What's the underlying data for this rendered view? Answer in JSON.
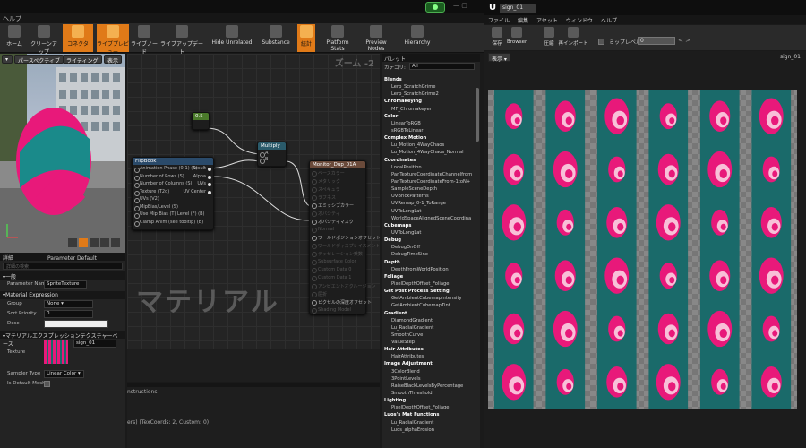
{
  "window": {
    "menu_label": "ヘルプ"
  },
  "toolbar": {
    "buttons": [
      {
        "label": "ホーム",
        "icon": "home-icon",
        "active": false
      },
      {
        "label": "クリーンアップ",
        "icon": "cleanup-icon",
        "active": false
      },
      {
        "label": "コネクタ",
        "icon": "connector-icon",
        "active": true
      },
      {
        "label": "ライブプレビュー",
        "icon": "live-preview-icon",
        "active": true
      },
      {
        "label": "ライブノード",
        "icon": "live-nodes-icon",
        "active": false
      },
      {
        "label": "ライブアップデート",
        "icon": "live-update-icon",
        "active": false
      },
      {
        "label": "Hide Unrelated",
        "icon": "hide-unrelated-icon",
        "active": false
      },
      {
        "label": "Substance",
        "icon": "substance-icon",
        "active": false
      },
      {
        "label": "統計",
        "icon": "stats-icon",
        "active": true
      },
      {
        "label": "Platform Stats",
        "icon": "platform-stats-icon",
        "active": false
      },
      {
        "label": "Preview Nodes",
        "icon": "preview-nodes-icon",
        "active": false
      },
      {
        "label": "Hierarchy",
        "icon": "hierarchy-icon",
        "active": false
      }
    ]
  },
  "viewport": {
    "perspective": "パースペクティブ",
    "lighting": "ライティング",
    "show": "表示"
  },
  "graph": {
    "zoom": "ズーム -2",
    "watermark": "マテリアル",
    "node_const": {
      "title": "0.5"
    },
    "node_multiply": {
      "title": "Multiply",
      "pins": [
        "A",
        "B"
      ]
    },
    "node_flipbook": {
      "title": "FlipBook",
      "inputs": [
        "Animation Phase (0-1) (S)",
        "Number of Rows (S)",
        "Number of Columns (S)",
        "Texture (T2d)",
        "UVs (V2)",
        "MipBias/Level (S)",
        "Use Mip Bias (T) Level (F) (B)",
        "Clamp Anim (see tooltip) (B)"
      ],
      "outputs": [
        "Result",
        "Alpha",
        "UVs",
        "UV Center"
      ]
    },
    "node_material": {
      "title": "Monitor_Dup_01A",
      "pins": [
        "ベースカラー",
        "メタリック",
        "スペキュラ",
        "ラフネス",
        "エミッシブカラー",
        "オパシティ",
        "オパシティマスク",
        "Normal",
        "ワールドポジションオフセット",
        "ワールドディスプレイスメント",
        "テッセレーション乗数",
        "Subsurface Color",
        "Custom Data 0",
        "Custom Data 1",
        "アンビエントオクルージョン",
        "屈折",
        "ピクセルの深度オフセット",
        "Shading Model"
      ],
      "active": [
        4,
        6,
        8,
        16
      ]
    }
  },
  "details": {
    "tab_details": "詳細",
    "tab_params": "Parameter Default",
    "search_placeholder": "詳細の検索",
    "sect_general": "一般",
    "param_name_label": "Parameter Name",
    "param_name_value": "SpriteTexture",
    "sect_material_expr": "Material Expression",
    "group_label": "Group",
    "group_value": "None",
    "sort_label": "Sort Priority",
    "sort_value": "0",
    "desc_label": "Desc",
    "sect_texture": "マテリアルエクスプレッションテクスチャーベース",
    "texture_label": "Texture",
    "texture_value": "sign_01",
    "sampler_label": "Sampler Type",
    "sampler_value": "Linear Color",
    "default_label": "Is Default Meshp"
  },
  "stats": {
    "line1": "nstructions",
    "line2": "ers) (TexCoords: 2, Custom: 0)"
  },
  "palette": {
    "tab": "パレット",
    "category_label": "カテゴリ:",
    "category_value": "All",
    "items": [
      {
        "t": "Blends",
        "c": true
      },
      {
        "t": "Lerp_ScratchGrime"
      },
      {
        "t": "Lerp_ScratchGrime2"
      },
      {
        "t": "Chromakeying",
        "c": true
      },
      {
        "t": "MF_Chromakeyer"
      },
      {
        "t": "Color",
        "c": true
      },
      {
        "t": "LinearToRGB"
      },
      {
        "t": "sRGBToLinear"
      },
      {
        "t": "Complex Motion",
        "c": true
      },
      {
        "t": "Lu_Motion_4WayChaos"
      },
      {
        "t": "Lu_Motion_4WayChaos_Normal"
      },
      {
        "t": "Coordinates",
        "c": true
      },
      {
        "t": "LocalPosition"
      },
      {
        "t": "PanTextureCoordinateChannelfrom"
      },
      {
        "t": "PanTextureCoordinateFrom-1toN+"
      },
      {
        "t": "SampleSceneDepth"
      },
      {
        "t": "UVBrickPatterns"
      },
      {
        "t": "UVRemap_0-1_ToRange"
      },
      {
        "t": "UVToLongLat"
      },
      {
        "t": "WorldSpaceAlignedSceneCoordina"
      },
      {
        "t": "Cubemaps",
        "c": true
      },
      {
        "t": "UVToLongLat"
      },
      {
        "t": "Debug",
        "c": true
      },
      {
        "t": "DebugOnOff"
      },
      {
        "t": "DebugTimeSine"
      },
      {
        "t": "Depth",
        "c": true
      },
      {
        "t": "DepthFromWorldPosition"
      },
      {
        "t": "Foliage",
        "c": true
      },
      {
        "t": "PixelDepthOffset_Foliage"
      },
      {
        "t": "Get Post Process Setting",
        "c": true
      },
      {
        "t": "GetAmbientCubemapIntensity"
      },
      {
        "t": "GetAmbientCubemapTint"
      },
      {
        "t": "Gradient",
        "c": true
      },
      {
        "t": "DiamondGradient"
      },
      {
        "t": "Lu_RadialGradient"
      },
      {
        "t": "SmoothCurve"
      },
      {
        "t": "ValueStep"
      },
      {
        "t": "Hair Attributes",
        "c": true
      },
      {
        "t": "HairAttributes"
      },
      {
        "t": "Image Adjustment",
        "c": true
      },
      {
        "t": "3ColorBlend"
      },
      {
        "t": "3PointLevels"
      },
      {
        "t": "RaiseBlackLevelsByPercentage"
      },
      {
        "t": "SmoothThreshold"
      },
      {
        "t": "Lighting",
        "c": true
      },
      {
        "t": "PixelDepthOffset_Foliage"
      },
      {
        "t": "Luos's Mat Functions",
        "c": true
      },
      {
        "t": "Lu_RadialGradient"
      },
      {
        "t": "Luos_alphaErosion"
      }
    ]
  },
  "texture_editor": {
    "tab": "sign_01",
    "menu": [
      "ファイル",
      "編集",
      "アセット",
      "ウィンドウ",
      "ヘルプ"
    ],
    "tools": [
      "保存",
      "Browser",
      "圧縮",
      "再インポート"
    ],
    "mip_label": "ミップレベル:",
    "mip_value": "0",
    "view_button": "表示",
    "viewport_label": "sign_01"
  },
  "colors": {
    "accent": "#e07a18",
    "pink": "#e8197a",
    "teal": "#1a6a6a"
  }
}
